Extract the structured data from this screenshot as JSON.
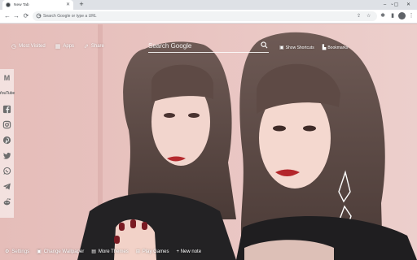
{
  "browser": {
    "tab": {
      "title": "New Tab"
    },
    "omnibox": {
      "placeholder": "Search Google or type a URL"
    }
  },
  "newtab": {
    "top_links": [
      {
        "label": "Most Visited",
        "icon": "history-icon"
      },
      {
        "label": "Apps",
        "icon": "apps-grid-icon"
      },
      {
        "label": "Share",
        "icon": "share-icon"
      }
    ],
    "search": {
      "placeholder": "Search Google"
    },
    "right_links": [
      {
        "label": "Show Shortcuts",
        "icon": "shortcuts-icon"
      },
      {
        "label": "Bookmarks",
        "icon": "bookmark-icon"
      }
    ],
    "social": [
      {
        "label": "M",
        "icon": "gmail-icon"
      },
      {
        "label": "YouTube",
        "icon": "youtube-icon"
      },
      {
        "label": "f",
        "icon": "facebook-icon"
      },
      {
        "label": "",
        "icon": "instagram-icon"
      },
      {
        "label": "",
        "icon": "pinterest-icon"
      },
      {
        "label": "",
        "icon": "twitter-icon"
      },
      {
        "label": "",
        "icon": "whatsapp-icon"
      },
      {
        "label": "",
        "icon": "telegram-icon"
      },
      {
        "label": "",
        "icon": "reddit-icon"
      }
    ],
    "bottom": [
      {
        "label": "Settings",
        "icon": "gear-icon"
      },
      {
        "label": "Change Wallpaper",
        "icon": "wallpaper-icon"
      },
      {
        "label": "More Themes",
        "icon": "themes-icon"
      },
      {
        "label": "Play Games",
        "icon": "gamepad-icon"
      },
      {
        "label": "+ New note",
        "icon": ""
      }
    ]
  }
}
